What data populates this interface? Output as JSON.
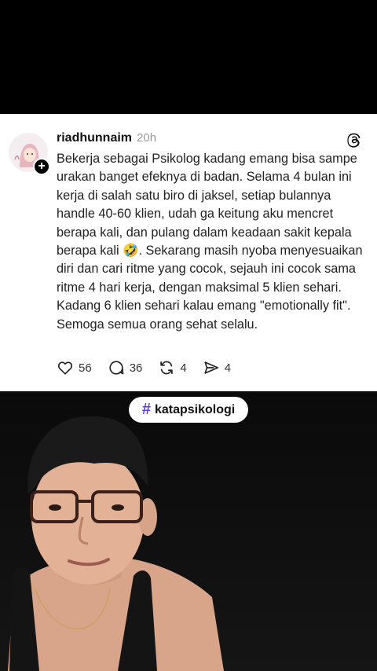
{
  "post": {
    "username": "riadhunnaim",
    "time": "20h",
    "text": "Bekerja sebagai Psikolog kadang emang bisa sampe urakan banget efeknya di badan. Selama 4 bulan ini kerja di salah satu biro di jaksel, setiap bulannya handle 40-60 klien, udah ga keitung aku mencret berapa kali, dan pulang dalam keadaan sakit kepala berapa kali 🤣. Sekarang masih nyoba menyesuaikan diri dan cari ritme yang cocok, sejauh ini cocok sama ritme 4 hari kerja, dengan maksimal 5 klien sehari. Kadang 6 klien sehari kalau emang \"emotionally fit\". Semoga semua orang sehat selalu.",
    "likes": "56",
    "replies": "36",
    "reposts": "4",
    "shares": "4"
  },
  "overlay": {
    "hashtag": "katapsikologi"
  },
  "icons": {
    "follow": "plus-icon",
    "app": "threads-logo-icon",
    "like": "heart-icon",
    "reply": "comment-icon",
    "repost": "repost-icon",
    "share": "send-icon",
    "hashtag": "hash-icon"
  },
  "colors": {
    "hashtag_accent": "#5b46d6"
  }
}
